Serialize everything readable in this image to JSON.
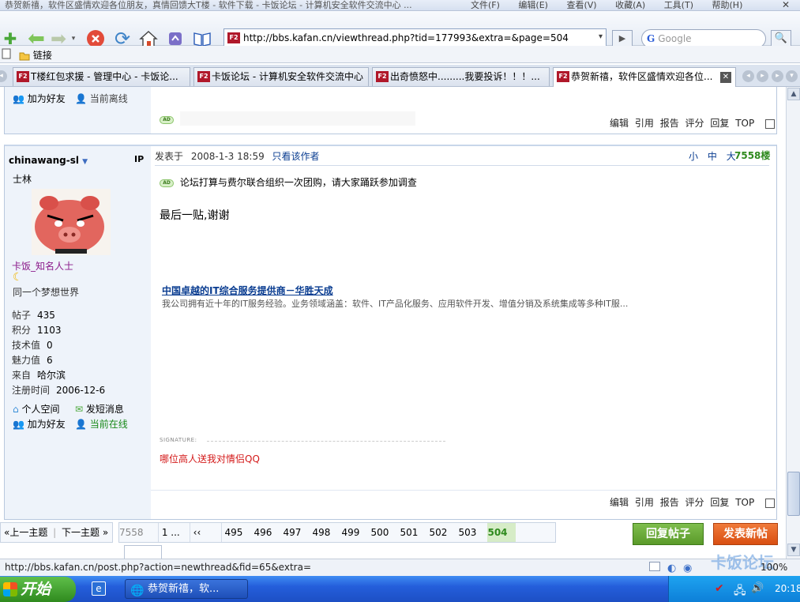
{
  "window": {
    "title": "恭贺新禧，软件区盛情欢迎各位朋友，真情回馈大T楼 - 软件下载 - 卡饭论坛 - 计算机安全软件交流中心 ...",
    "menu": [
      "文件(F)",
      "编辑(E)",
      "查看(V)",
      "收藏(A)",
      "工具(T)",
      "帮助(H)"
    ]
  },
  "navbar": {
    "favicon_text": "F2",
    "url": "http://bbs.kafan.cn/viewthread.php?tid=177993&extra=&page=504",
    "search_placeholder": "Google",
    "search_logo": "G",
    "go_label": "▶",
    "search_btn": "🔍"
  },
  "links_bar": {
    "label": "链接"
  },
  "tabs": [
    {
      "label": "T楼红包求援 - 管理中心 - 卡饭论..."
    },
    {
      "label": "卡饭论坛 - 计算机安全软件交流中心"
    },
    {
      "label": "出奇愤怒中.........我要投诉！！！..."
    },
    {
      "label": "恭贺新禧，软件区盛情欢迎各位..."
    }
  ],
  "prev_post": {
    "add_friend": "加为好友",
    "status": "当前离线",
    "ad_badge": "AD",
    "actions": [
      "编辑",
      "引用",
      "报告",
      "评分",
      "回复",
      "TOP"
    ]
  },
  "post": {
    "author": "chinawang-sl",
    "ip_label": "IP",
    "rank_title": "士林",
    "group": "卡饭_知名人士",
    "custom_title": "同一个梦想世界",
    "stats": [
      {
        "label": "帖子",
        "value": "435"
      },
      {
        "label": "积分",
        "value": "1103"
      },
      {
        "label": "技术值",
        "value": "0"
      },
      {
        "label": "魅力值",
        "value": "6"
      },
      {
        "label": "来自",
        "value": "哈尔滨"
      },
      {
        "label": "注册时间",
        "value": "2006-12-6"
      }
    ],
    "links": {
      "space": "个人空间",
      "message": "发短消息",
      "add_friend": "加为好友",
      "online": "当前在线"
    },
    "posted_prefix": "发表于",
    "posted_time": "2008-1-3 18:59",
    "only_author": "只看该作者",
    "font_sizes": [
      "小",
      "中",
      "大"
    ],
    "floor": "7558楼",
    "ad_badge": "AD",
    "ad_text": "论坛打算与费尔联合组织一次团购，请大家踊跃参加调查",
    "body": "最后一贴,谢谢",
    "promo_title": "中国卓越的IT综合服务提供商－华胜天成",
    "promo_desc": "我公司拥有近十年的IT服务经验。业务领域涵盖：软件、IT产品化服务、应用软件开发、增值分销及系统集成等多种IT服...",
    "signature_label": "SIGNATURE:",
    "signature": "哪位高人送我对情侣QQ",
    "actions": [
      "编辑",
      "引用",
      "报告",
      "评分",
      "回复",
      "TOP"
    ]
  },
  "pager": {
    "prev_thread": "«上一主题",
    "next_thread": "下一主题 »",
    "total": "7558",
    "first": "1 ...",
    "prev": "‹‹",
    "pages": [
      "495",
      "496",
      "497",
      "498",
      "499",
      "500",
      "501",
      "502",
      "503"
    ],
    "current": "504",
    "reply_button": "回复帖子",
    "new_button": "发表新帖"
  },
  "status_bar": {
    "url": "http://bbs.kafan.cn/post.php?action=newthread&fid=65&extra=",
    "zoom": "100%"
  },
  "taskbar": {
    "start": "开始",
    "task": "恭贺新禧，软...",
    "clock": "20:18"
  }
}
